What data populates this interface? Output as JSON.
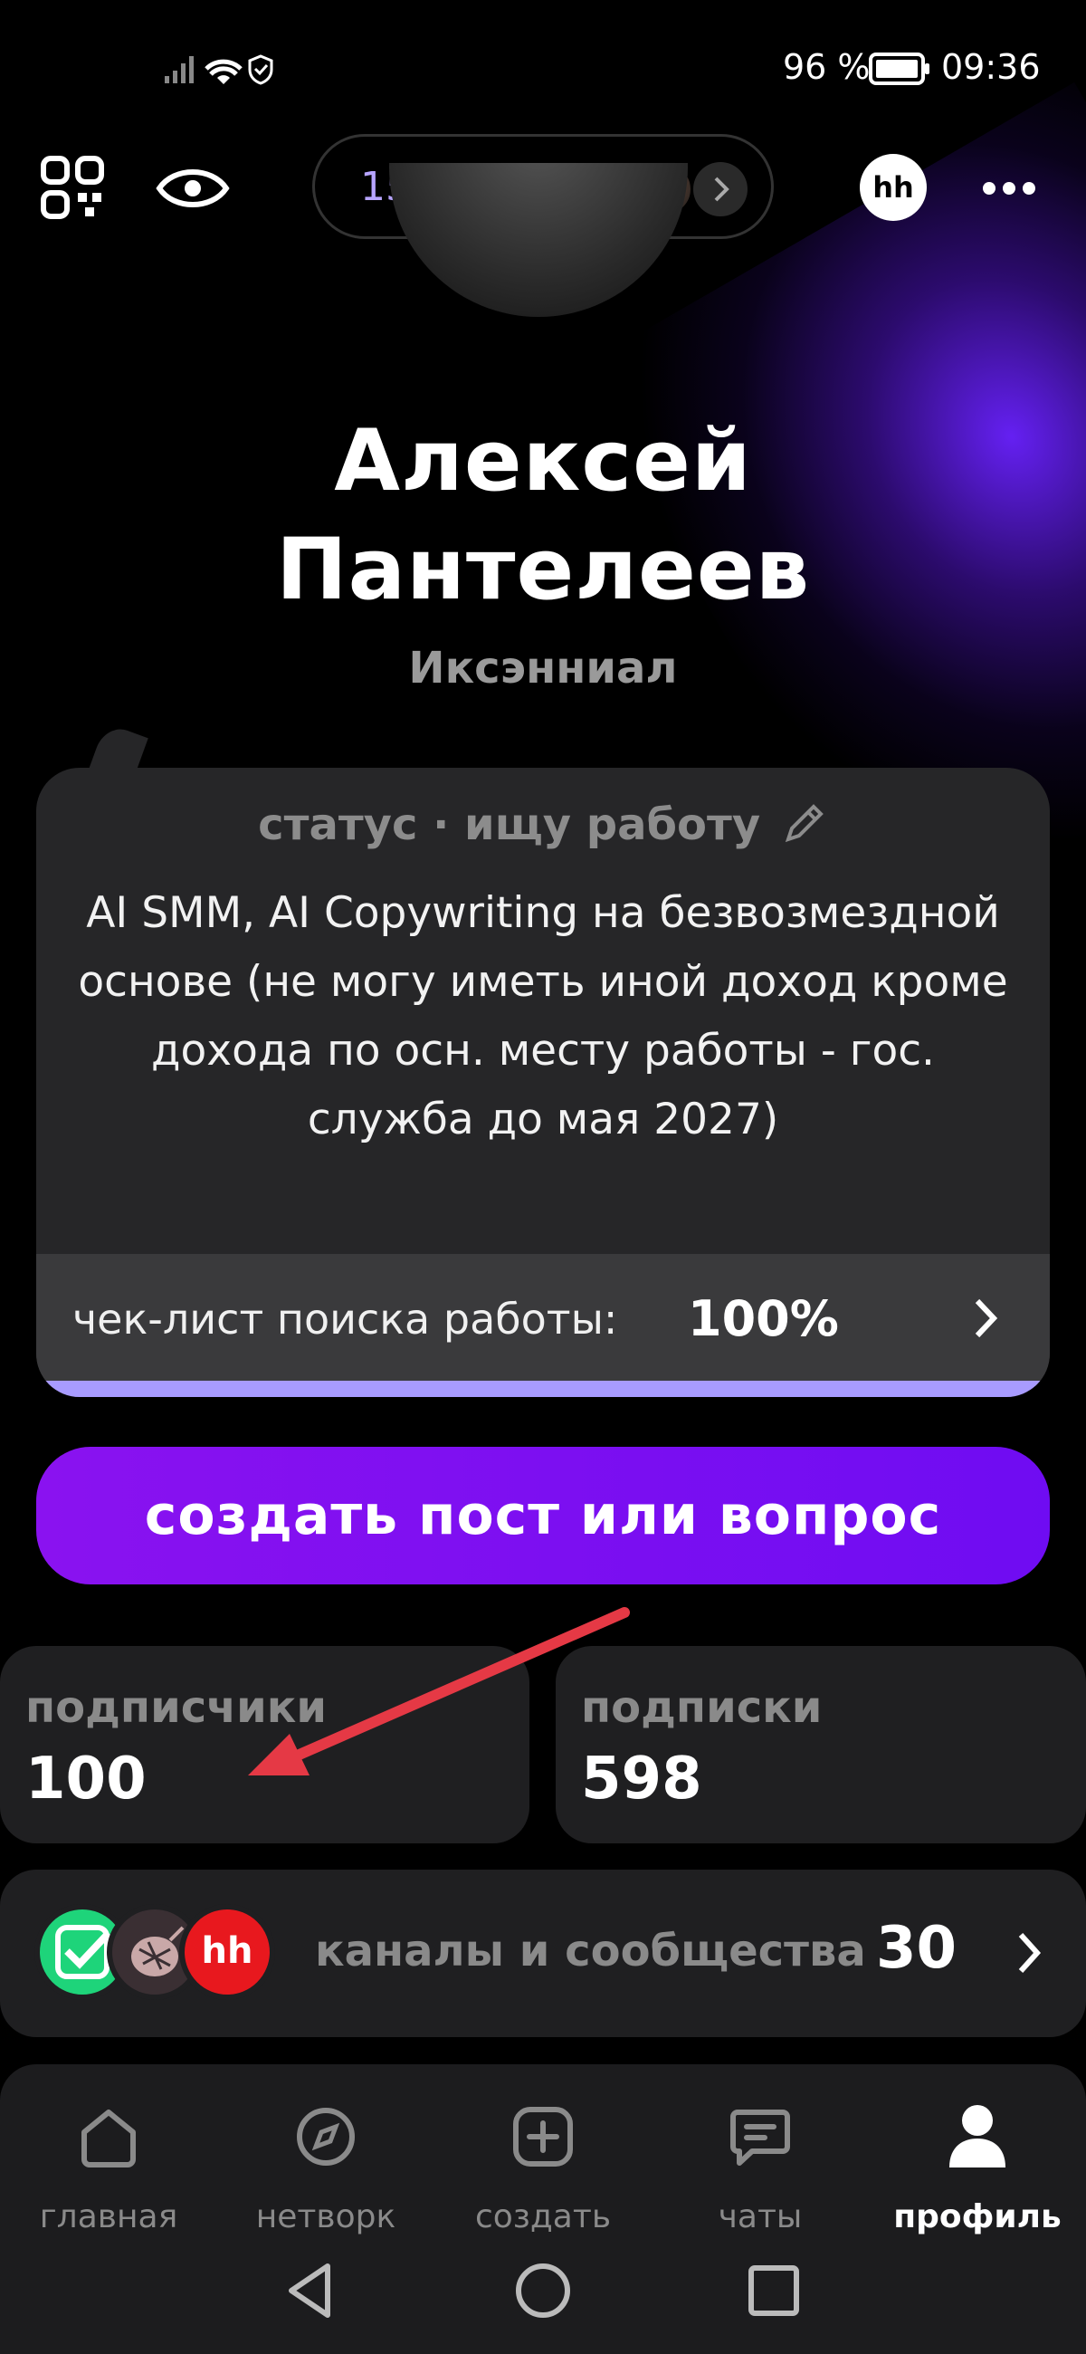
{
  "status_bar": {
    "time": "09:36",
    "battery": "96 %"
  },
  "header": {
    "links_label": "152 связи",
    "hh_badge": "hh"
  },
  "profile": {
    "name_line1": "Алексей",
    "name_line2": "Пантелеев",
    "subtitle": "Иксэнниал"
  },
  "status_card": {
    "heading": "статус · ищу работу",
    "text": "AI SMM, AI Copywriting на безвозмездной основе (не могу иметь иной доход кроме дохода по осн. месту работы - гос. служба до мая 2027)",
    "checklist_label": "чек-лист поиска работы:",
    "checklist_value": "100%",
    "checklist_progress": 1.0
  },
  "create_button": "создать пост или вопрос",
  "stats": {
    "followers_label": "подписчики",
    "followers_value": "100",
    "following_label": "подписки",
    "following_value": "598"
  },
  "channels": {
    "label": "каналы и сообщества",
    "count": "30",
    "icon3_text": "hh"
  },
  "bottom_nav": [
    {
      "label": "главная",
      "icon": "home-icon"
    },
    {
      "label": "нетворк",
      "icon": "compass-icon"
    },
    {
      "label": "создать",
      "icon": "plus-square-icon"
    },
    {
      "label": "чаты",
      "icon": "chat-icon"
    },
    {
      "label": "профиль",
      "icon": "user-icon"
    }
  ],
  "colors": {
    "accent": "#7a12f2",
    "links_text": "#b7a4ff",
    "checklist_bar": "#a89bff",
    "annotation_arrow": "#e53945"
  }
}
